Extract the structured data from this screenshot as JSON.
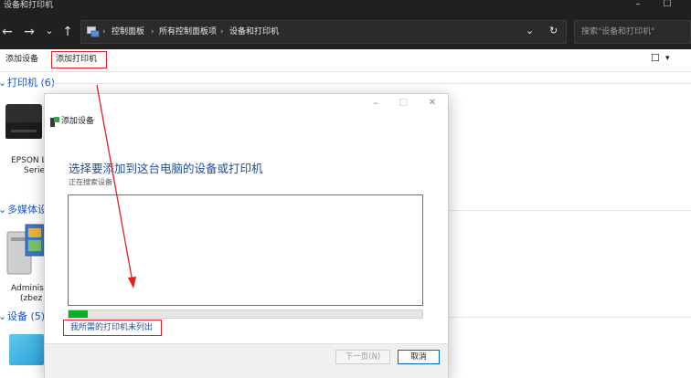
{
  "window": {
    "title": "设备和打印机",
    "controls": {
      "minimize": "–",
      "maximize": "☐"
    }
  },
  "nav": {
    "back": "←",
    "forward": "→",
    "recent": "⌄",
    "up": "↑",
    "breadcrumbs": [
      "控制面板",
      "所有控制面板项",
      "设备和打印机"
    ],
    "dropdown": "⌄",
    "refresh": "↻",
    "search_placeholder": "搜索\"设备和打印机\""
  },
  "commands": {
    "add_device": "添加设备",
    "add_printer": "添加打印机",
    "view_icon": "☐",
    "view_menu": "▾"
  },
  "groups": [
    {
      "label": "打印机 (6)",
      "chevron": "⌄"
    },
    {
      "label": "多媒体设备",
      "chevron": "⌄"
    },
    {
      "label": "设备 (5)",
      "chevron": "⌄"
    }
  ],
  "devices": {
    "printer_line1": "EPSON L",
    "printer_line2": "Serie",
    "media_line1": "Administ",
    "media_line2": "(zbez"
  },
  "dialog": {
    "title": "添加设备",
    "controls": {
      "minimize": "–",
      "maximize": "☐",
      "close": "✕"
    },
    "heading": "选择要添加到这台电脑的设备或打印机",
    "status": "正在搜索设备",
    "progress_fraction": 0.055,
    "not_listed_link": "我所需的打印机未列出",
    "next_button": "下一页(N)",
    "cancel_button": "取消"
  },
  "colors": {
    "accent": "#1a4fa0",
    "highlight": "#e02020",
    "progress": "#06b025",
    "dark_chrome": "#202020"
  }
}
